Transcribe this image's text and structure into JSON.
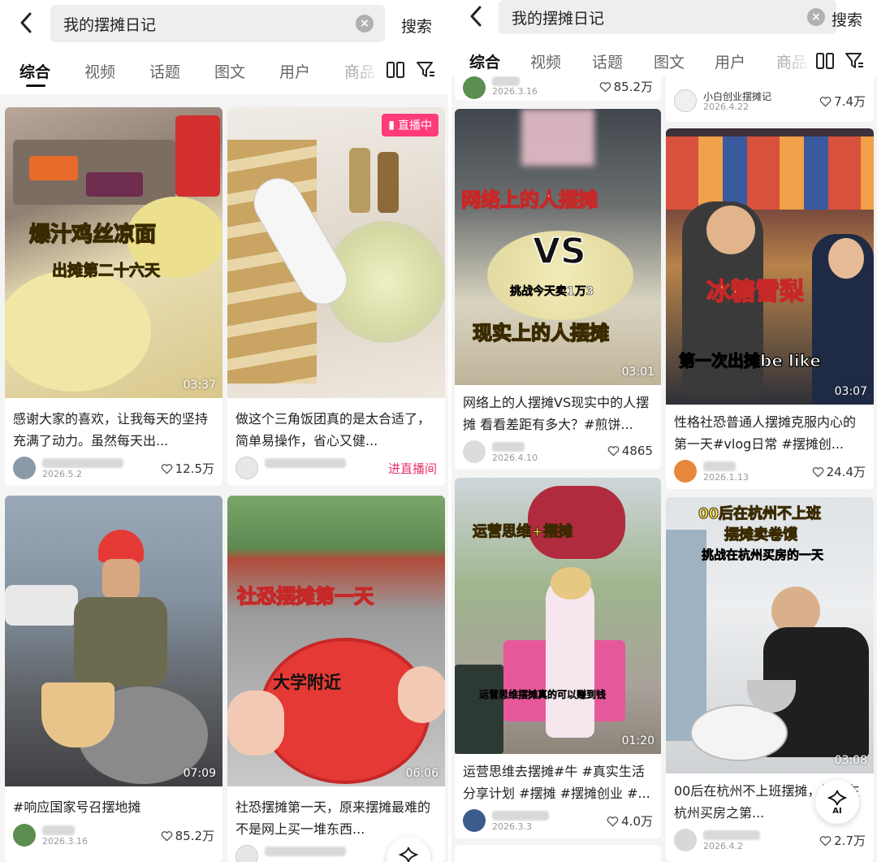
{
  "left": {
    "search": {
      "query": "我的摆摊日记",
      "button": "搜索"
    },
    "tabs": [
      "综合",
      "视频",
      "话题",
      "图文",
      "用户",
      "商品"
    ],
    "cards": [
      {
        "overlay1": "爆汁鸡丝凉面",
        "overlay2": "出摊第二十六天",
        "duration": "03:37",
        "title": "感谢大家的喜欢，让我每天的坚持充满了动力。虽然每天出...",
        "date": "2026.5.2",
        "likes": "12.5万"
      },
      {
        "live_badge": "直播中",
        "title": "做这个三角饭团真的是太合适了，简单易操作，省心又健...",
        "live_link": "进直播间"
      },
      {
        "duration": "07:09",
        "title": "#响应国家号召摆地摊",
        "date": "2026.3.16",
        "likes": "85.2万"
      },
      {
        "overlay1": "社恐摆摊第一天",
        "overlay2": "大学附近",
        "duration": "06:06",
        "title": "社恐摆摊第一天，原来摆摊最难的不是网上买一堆东西..."
      }
    ]
  },
  "right": {
    "search": {
      "query": "我的摆摊日记",
      "button": "搜索"
    },
    "tabs": [
      "综合",
      "视频",
      "话题",
      "图文",
      "用户",
      "商品"
    ],
    "top_partial": [
      {
        "date": "2026.3.16",
        "likes": "85.2万"
      },
      {
        "author": "小白创业摆摊记",
        "date": "2026.4.22",
        "likes": "7.4万"
      }
    ],
    "cards": [
      {
        "overlay1": "网络上的人摆摊",
        "overlay_vs": "VS",
        "overlay_small": "挑战今天卖1万3",
        "overlay2": "现实上的人摆摊",
        "duration": "03:01",
        "title": "网络上的人摆摊VS现实中的人摆摊 看看差距有多大？#煎饼...",
        "date": "2026.4.10",
        "likes": "4865"
      },
      {
        "overlay1": "冰糖雪梨",
        "overlay2": "第一次出摊be like",
        "duration": "03:07",
        "title": "性格社恐普通人摆摊克服内心的第一天#vlog日常 #摆摊创...",
        "date": "2026.1.13",
        "likes": "24.4万"
      },
      {
        "overlay1": "运营思维+摆摊",
        "overlay2": "运营思维摆摊真的可以赚到钱",
        "duration": "01:20",
        "title": "运营思维去摆摊#牛 #真实生活分享计划 #摆摊 #摆摊创业 #...",
        "date": "2026.3.3",
        "likes": "4.0万"
      },
      {
        "overlay1": "00后在杭州不上班",
        "overlay2": "摆摊卖卷馍",
        "overlay3": "挑战在杭州买房的一天",
        "duration": "03:08",
        "title": "00后在杭州不上班摆摊，挑战在杭州买房之第...",
        "date": "2026.4.2",
        "likes": "2.7万"
      }
    ]
  },
  "ai_label": "AI",
  "colors": {
    "accent_pink": "#ff3b7a",
    "live_text": "#e8356b",
    "overlay_yellow": "#ffe14a"
  }
}
